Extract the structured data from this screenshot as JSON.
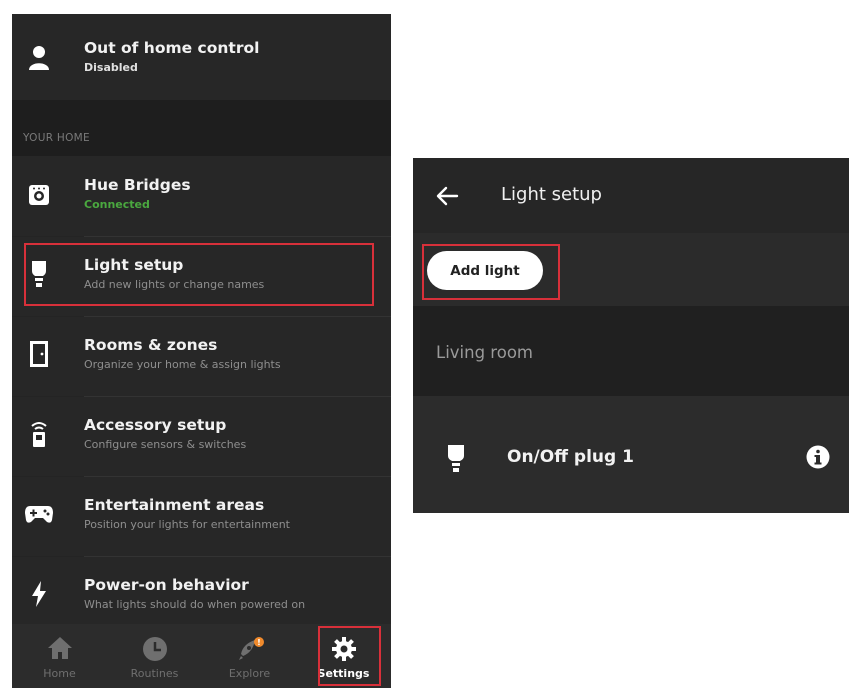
{
  "left_screen": {
    "top_item": {
      "title": "Out of home control",
      "subtitle": "Disabled",
      "icon": "person-icon"
    },
    "section_label": "YOUR HOME",
    "items": [
      {
        "title": "Hue Bridges",
        "subtitle": "Connected",
        "icon": "bridge-icon",
        "subtitle_color": "#4aa83f"
      },
      {
        "title": "Light setup",
        "subtitle": "Add new lights or change names",
        "icon": "bulb-icon",
        "highlighted": true
      },
      {
        "title": "Rooms & zones",
        "subtitle": "Organize your home & assign lights",
        "icon": "door-icon"
      },
      {
        "title": "Accessory setup",
        "subtitle": "Configure sensors & switches",
        "icon": "switch-icon"
      },
      {
        "title": "Entertainment areas",
        "subtitle": "Position your lights for entertainment",
        "icon": "gamepad-icon"
      },
      {
        "title": "Power-on behavior",
        "subtitle": "What lights should do when powered on",
        "icon": "lightning-icon"
      }
    ],
    "nav": [
      {
        "label": "Home",
        "icon": "home-icon"
      },
      {
        "label": "Routines",
        "icon": "clock-icon"
      },
      {
        "label": "Explore",
        "icon": "rocket-icon",
        "badge": "!"
      },
      {
        "label": "Settings",
        "icon": "gear-icon",
        "active": true
      }
    ]
  },
  "right_screen": {
    "title": "Light setup",
    "add_button": "Add light",
    "group_label": "Living room",
    "light_item": "On/Off plug 1"
  },
  "colors": {
    "highlight": "#d8303a",
    "connected": "#4aa83f",
    "badge": "#f08a2c"
  }
}
